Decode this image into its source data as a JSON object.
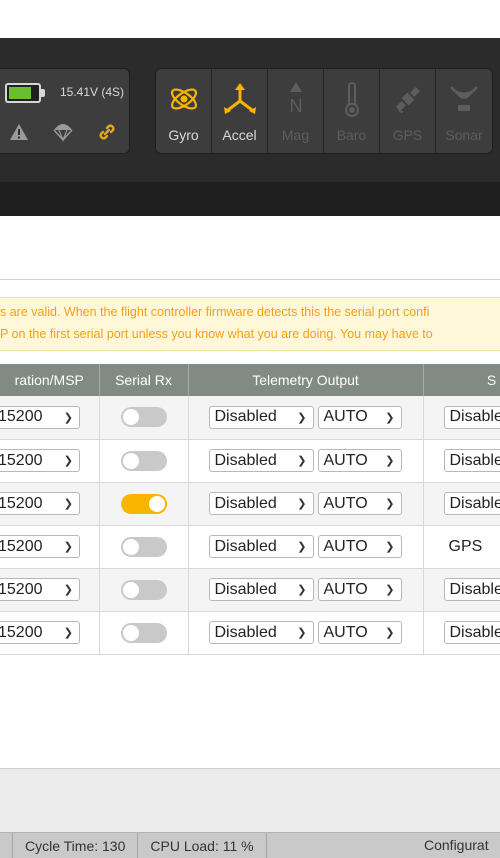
{
  "header": {
    "battery": {
      "voltage": "15.41V (4S)",
      "charge_fraction": 0.8,
      "fill_color": "#6abf2e"
    },
    "status_icons": [
      "warning-icon",
      "failsafe-icon",
      "link-icon"
    ],
    "sensors": [
      {
        "label": "Gyro",
        "active": true
      },
      {
        "label": "Accel",
        "active": true
      },
      {
        "label": "Mag",
        "active": false
      },
      {
        "label": "Baro",
        "active": false
      },
      {
        "label": "GPS",
        "active": false
      },
      {
        "label": "Sonar",
        "active": false
      }
    ],
    "active_color": "#f7b500"
  },
  "note": {
    "line1": "s are valid. When the flight controller firmware detects this the serial port confi",
    "line2": "P on the first serial port unless you know what you are doing. You may have to"
  },
  "ports": {
    "columns": [
      "ration/MSP",
      "Serial Rx",
      "Telemetry Output",
      "S"
    ],
    "rows": [
      {
        "baud": "15200",
        "serial_rx": false,
        "telemetry": "Disabled",
        "telemetry_baud": "AUTO",
        "sensor": "Disable",
        "sensor_is_select": true
      },
      {
        "baud": "15200",
        "serial_rx": false,
        "telemetry": "Disabled",
        "telemetry_baud": "AUTO",
        "sensor": "Disable",
        "sensor_is_select": true
      },
      {
        "baud": "15200",
        "serial_rx": true,
        "telemetry": "Disabled",
        "telemetry_baud": "AUTO",
        "sensor": "Disable",
        "sensor_is_select": true
      },
      {
        "baud": "15200",
        "serial_rx": false,
        "telemetry": "Disabled",
        "telemetry_baud": "AUTO",
        "sensor": "GPS",
        "sensor_is_select": false
      },
      {
        "baud": "15200",
        "serial_rx": false,
        "telemetry": "Disabled",
        "telemetry_baud": "AUTO",
        "sensor": "Disable",
        "sensor_is_select": true
      },
      {
        "baud": "15200",
        "serial_rx": false,
        "telemetry": "Disabled",
        "telemetry_baud": "AUTO",
        "sensor": "Disable",
        "sensor_is_select": true
      }
    ]
  },
  "status_bar": {
    "cycle_time": "Cycle Time: 130",
    "cpu_load": "CPU Load: 11 %",
    "config": "Configurat"
  }
}
